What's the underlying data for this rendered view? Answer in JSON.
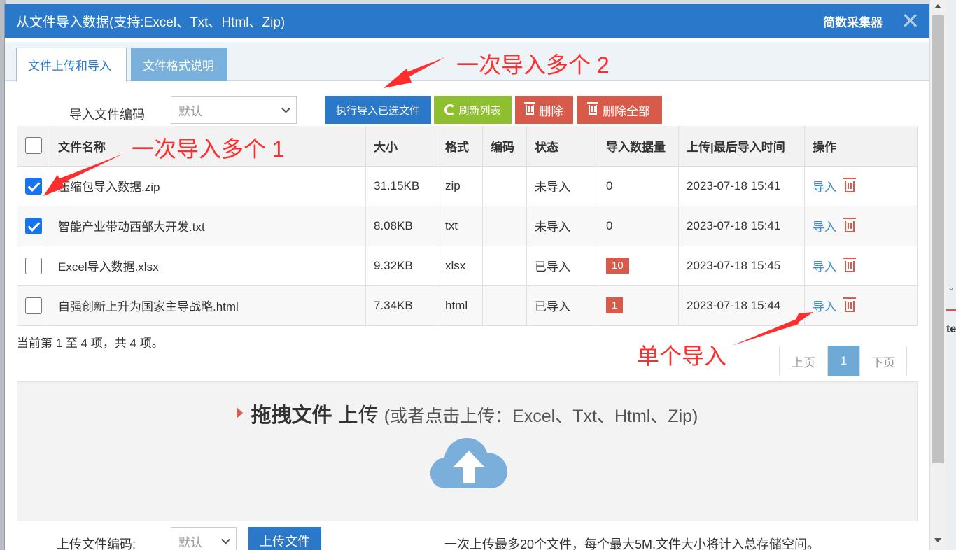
{
  "dialog": {
    "title": "从文件导入数据(支持:Excel、Txt、Html、Zip)",
    "brand": "简数采集器",
    "close_symbol": "✕"
  },
  "tabs": [
    {
      "label": "文件上传和导入",
      "active": true
    },
    {
      "label": "文件格式说明",
      "active": false
    }
  ],
  "toolbar": {
    "encoding_label": "导入文件编码",
    "encoding_value": "默认",
    "import_selected": "执行导入已选文件",
    "refresh": "刷新列表",
    "delete": "删除",
    "delete_all": "删除全部"
  },
  "table": {
    "headers": [
      "文件名称",
      "大小",
      "格式",
      "编码",
      "状态",
      "导入数据量",
      "上传|最后导入时间",
      "操作"
    ],
    "rows": [
      {
        "checked": true,
        "name": "压缩包导入数据.zip",
        "size": "31.15KB",
        "format": "zip",
        "encoding": "",
        "status": "未导入",
        "count": "0",
        "badge": false,
        "time": "2023-07-18 15:41",
        "action": "导入"
      },
      {
        "checked": true,
        "name": "智能产业带动西部大开发.txt",
        "size": "8.08KB",
        "format": "txt",
        "encoding": "",
        "status": "未导入",
        "count": "0",
        "badge": false,
        "time": "2023-07-18 15:41",
        "action": "导入"
      },
      {
        "checked": false,
        "name": "Excel导入数据.xlsx",
        "size": "9.32KB",
        "format": "xlsx",
        "encoding": "",
        "status": "已导入",
        "count": "10",
        "badge": true,
        "time": "2023-07-18 15:45",
        "action": "导入"
      },
      {
        "checked": false,
        "name": "自强创新上升为国家主导战略.html",
        "size": "7.34KB",
        "format": "html",
        "encoding": "",
        "status": "已导入",
        "count": "1",
        "badge": true,
        "time": "2023-07-18 15:44",
        "action": "导入"
      }
    ]
  },
  "summary": "当前第 1 至 4 项，共 4 项。",
  "pagination": {
    "prev": "上页",
    "current": "1",
    "next": "下页"
  },
  "dropzone": {
    "strong": "拖拽文件",
    "action": "上传",
    "hint": "(或者点击上传：Excel、Txt、Html、Zip)"
  },
  "upload": {
    "encoding_label": "上传文件编码:",
    "encoding_value": "默认",
    "button": "上传文件",
    "note": "一次上传最多20个文件，每个最大5M.文件大小将计入总存储空间。"
  },
  "annotations": {
    "multi_1": "一次导入多个 1",
    "multi_2": "一次导入多个 2",
    "single": "单个导入",
    "color": "#ff2d2d"
  },
  "colors": {
    "title_bar": "#2a78c9",
    "primary": "#2a78c9",
    "success": "#8dbf2e",
    "danger": "#d75a4a"
  }
}
